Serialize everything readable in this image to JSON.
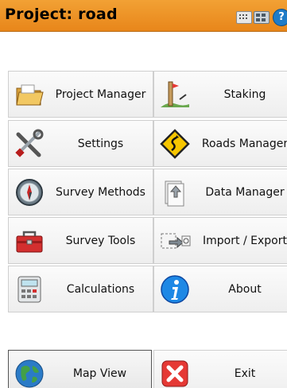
{
  "window": {
    "title": "Project: road"
  },
  "icons": {
    "keyboard": "keyboard-icon",
    "grid": "grid-icon",
    "help": "help-icon"
  },
  "menu": [
    {
      "label": "Project Manager",
      "icon": "folder-icon"
    },
    {
      "label": "Staking",
      "icon": "staking-icon"
    },
    {
      "label": "Settings",
      "icon": "tools-icon"
    },
    {
      "label": "Roads Manager",
      "icon": "road-sign-icon"
    },
    {
      "label": "Survey Methods",
      "icon": "compass-icon"
    },
    {
      "label": "Data Manager",
      "icon": "data-manager-icon"
    },
    {
      "label": "Survey Tools",
      "icon": "toolbox-icon"
    },
    {
      "label": "Import / Export",
      "icon": "import-export-icon"
    },
    {
      "label": "Calculations",
      "icon": "calculator-icon"
    },
    {
      "label": "About",
      "icon": "info-icon"
    }
  ],
  "bottom": [
    {
      "label": "Map View",
      "icon": "globe-icon"
    },
    {
      "label": "Exit",
      "icon": "exit-icon"
    }
  ],
  "colors": {
    "titlebar": "#e8861a",
    "button_bg": "#f3f3f3",
    "button_border": "#cfcfcf"
  }
}
